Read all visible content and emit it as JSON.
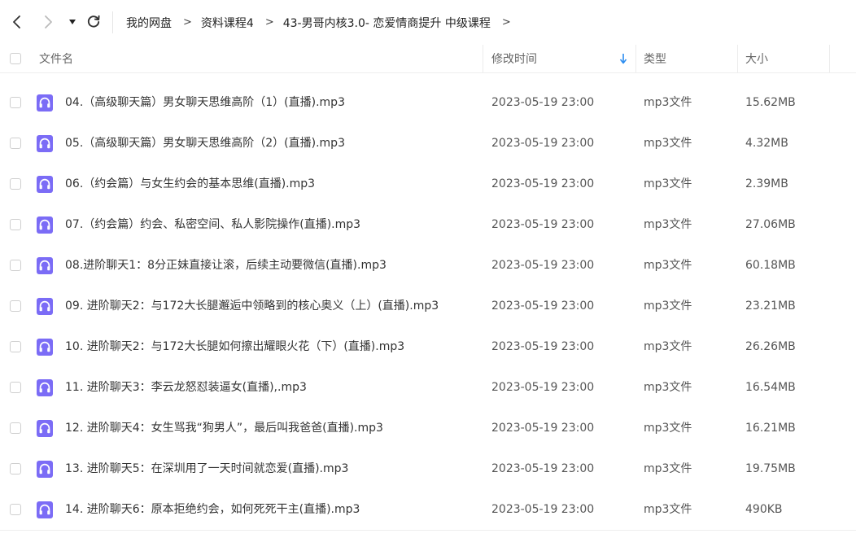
{
  "nav": {
    "back_icon": "chevron-left-icon",
    "forward_icon": "chevron-right-icon",
    "dropdown_icon": "caret-down-icon",
    "refresh_icon": "refresh-icon"
  },
  "breadcrumb": [
    {
      "label": "我的网盘"
    },
    {
      "label": "资料课程4"
    },
    {
      "label": "43-男哥内核3.0- 恋爱情商提升 中级课程"
    }
  ],
  "header": {
    "name": "文件名",
    "modified": "修改时间",
    "type": "类型",
    "size": "大小",
    "sort_icon": "sort-down-arrow-icon",
    "sort_color": "#2b8cf0"
  },
  "colors": {
    "icon_bg": "#7b6cf6",
    "divider": "#eeeeee"
  },
  "files": [
    {
      "name": "04.（高级聊天篇）男女聊天思维高阶（1）(直播).mp3",
      "modified": "2023-05-19 23:00",
      "type": "mp3文件",
      "size": "15.62MB"
    },
    {
      "name": "05.（高级聊天篇）男女聊天思维高阶（2）(直播).mp3",
      "modified": "2023-05-19 23:00",
      "type": "mp3文件",
      "size": "4.32MB"
    },
    {
      "name": "06.（约会篇）与女生约会的基本思维(直播).mp3",
      "modified": "2023-05-19 23:00",
      "type": "mp3文件",
      "size": "2.39MB"
    },
    {
      "name": "07.（约会篇）约会、私密空间、私人影院操作(直播).mp3",
      "modified": "2023-05-19 23:00",
      "type": "mp3文件",
      "size": "27.06MB"
    },
    {
      "name": "08.进阶聊天1：8分正妹直接让滚，后续主动要微信(直播).mp3",
      "modified": "2023-05-19 23:00",
      "type": "mp3文件",
      "size": "60.18MB"
    },
    {
      "name": "09. 进阶聊天2：与172大长腿邂逅中领略到的核心奥义（上）(直播).mp3",
      "modified": "2023-05-19 23:00",
      "type": "mp3文件",
      "size": "23.21MB"
    },
    {
      "name": "10. 进阶聊天2：与172大长腿如何擦出耀眼火花（下）(直播).mp3",
      "modified": "2023-05-19 23:00",
      "type": "mp3文件",
      "size": "26.26MB"
    },
    {
      "name": "11. 进阶聊天3：李云龙怒怼装逼女(直播),.mp3",
      "modified": "2023-05-19 23:00",
      "type": "mp3文件",
      "size": "16.54MB"
    },
    {
      "name": "12. 进阶聊天4：女生骂我“狗男人”，最后叫我爸爸(直播).mp3",
      "modified": "2023-05-19 23:00",
      "type": "mp3文件",
      "size": "16.21MB"
    },
    {
      "name": "13. 进阶聊天5：在深圳用了一天时间就恋爱(直播).mp3",
      "modified": "2023-05-19 23:00",
      "type": "mp3文件",
      "size": "19.75MB"
    },
    {
      "name": "14. 进阶聊天6：原本拒绝约会，如何死死干主(直播).mp3",
      "modified": "2023-05-19 23:00",
      "type": "mp3文件",
      "size": "490KB"
    }
  ]
}
